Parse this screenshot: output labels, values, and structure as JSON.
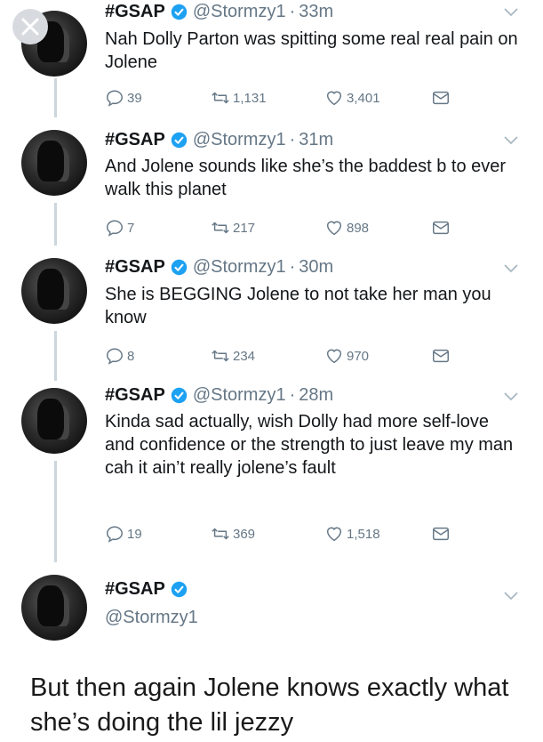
{
  "tweets": [
    {
      "name": "#GSAP",
      "handle": "@Stormzy1",
      "separator": "·",
      "time": "33m",
      "text": "Nah Dolly Parton was spitting some real real pain on Jolene",
      "replies": "39",
      "retweets": "1,131",
      "likes": "3,401"
    },
    {
      "name": "#GSAP",
      "handle": "@Stormzy1",
      "separator": "·",
      "time": "31m",
      "text": "And Jolene sounds like she’s the baddest b to ever walk this planet",
      "replies": "7",
      "retweets": "217",
      "likes": "898"
    },
    {
      "name": "#GSAP",
      "handle": "@Stormzy1",
      "separator": "·",
      "time": "30m",
      "text": "She is BEGGING Jolene to not take her man you know",
      "replies": "8",
      "retweets": "234",
      "likes": "970"
    },
    {
      "name": "#GSAP",
      "handle": "@Stormzy1",
      "separator": "·",
      "time": "28m",
      "text": "Kinda sad actually, wish Dolly had more self-love and confidence or the strength to just leave my man cah it ain’t really jolene’s fault",
      "replies": "19",
      "retweets": "369",
      "likes": "1,518"
    }
  ],
  "main_tweet": {
    "name": "#GSAP",
    "handle": "@Stormzy1",
    "text": "But then again Jolene knows exactly what she’s doing the lil jezzy"
  },
  "icons": {
    "close": "close-icon",
    "verified": "verified-badge-icon",
    "chevron": "chevron-down-icon",
    "reply": "reply-icon",
    "retweet": "retweet-icon",
    "like": "heart-icon",
    "dm": "mail-icon"
  },
  "colors": {
    "verified": "#1da1f2",
    "secondary": "#657786",
    "thread_line": "#ccd6dd"
  }
}
